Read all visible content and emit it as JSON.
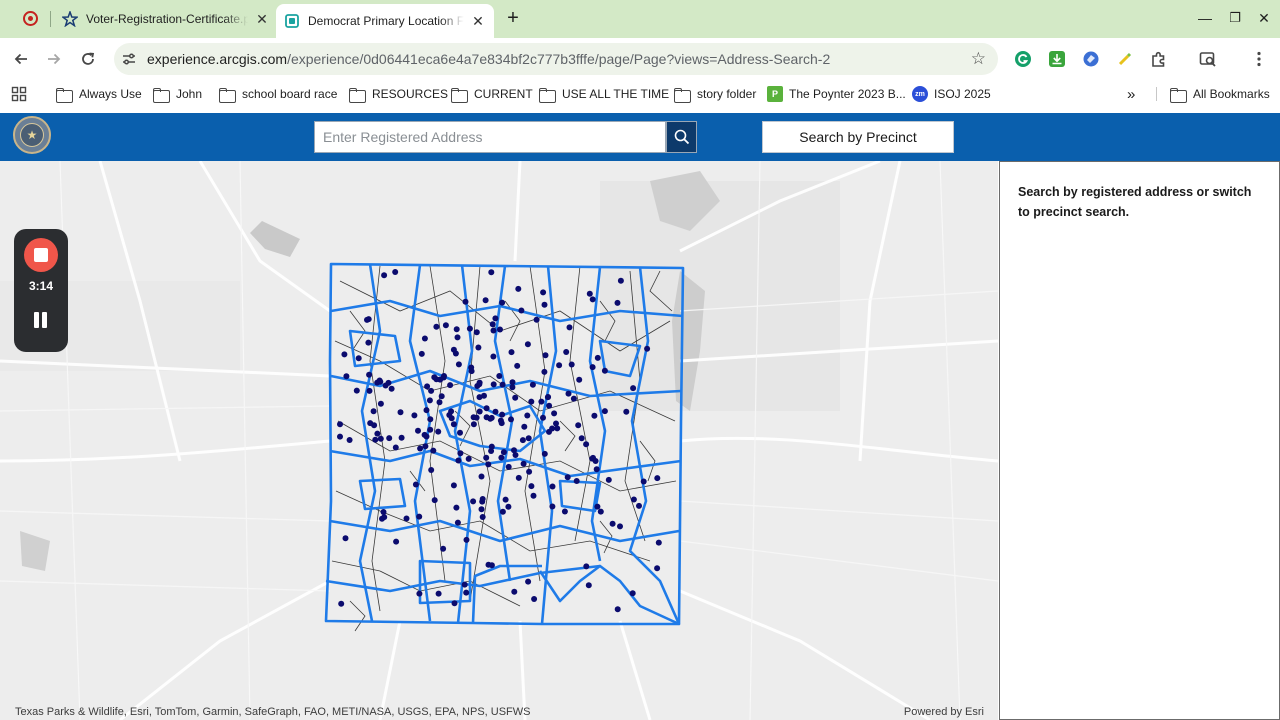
{
  "browser": {
    "tabs": [
      {
        "title": "Voter-Registration-Certificate.pdf",
        "favicon": "acrobat-star-icon",
        "active": false
      },
      {
        "title": "Democrat Primary Location Finder",
        "favicon": "arcgis-experience-icon",
        "active": true
      }
    ],
    "window_controls": {
      "minimize": "—",
      "restore": "❐",
      "close": "✕"
    },
    "new_tab_symbol": "+",
    "url_host": "experience.arcgis.com",
    "url_path": "/experience/0d06441eca6e4a7e834bf2c777b3fffe/page/Page?views=Address-Search-2",
    "bookmarks": [
      {
        "label": "Always Use",
        "icon": "folder-icon"
      },
      {
        "label": "John",
        "icon": "folder-icon"
      },
      {
        "label": "school board race",
        "icon": "folder-icon"
      },
      {
        "label": "RESOURCES",
        "icon": "folder-icon"
      },
      {
        "label": "CURRENT",
        "icon": "folder-icon"
      },
      {
        "label": "USE ALL THE TIME",
        "icon": "folder-icon"
      },
      {
        "label": "story folder",
        "icon": "folder-icon"
      },
      {
        "label": "The Poynter 2023 B...",
        "icon": "poynter-icon"
      },
      {
        "label": "ISOJ 2025",
        "icon": "zoom-icon"
      }
    ],
    "bookmarks_overflow": "»",
    "all_bookmarks": "All Bookmarks"
  },
  "app": {
    "search_placeholder": "Enter Registered Address",
    "precinct_button": "Search by Precinct",
    "side_panel_text": "Search by registered address or switch to precinct search.",
    "accent_color": "#0a5fad",
    "precinct_line_color": "#1f7be8",
    "poll_dot_color": "#0b0b6e"
  },
  "map": {
    "attribution": "Texas Parks & Wildlife, Esri, TomTom, Garmin, SafeGraph, FAO, METI/NASA, USGS, EPA, NPS, USFWS",
    "powered_by": "Powered by Esri"
  },
  "recorder": {
    "elapsed": "3:14"
  }
}
